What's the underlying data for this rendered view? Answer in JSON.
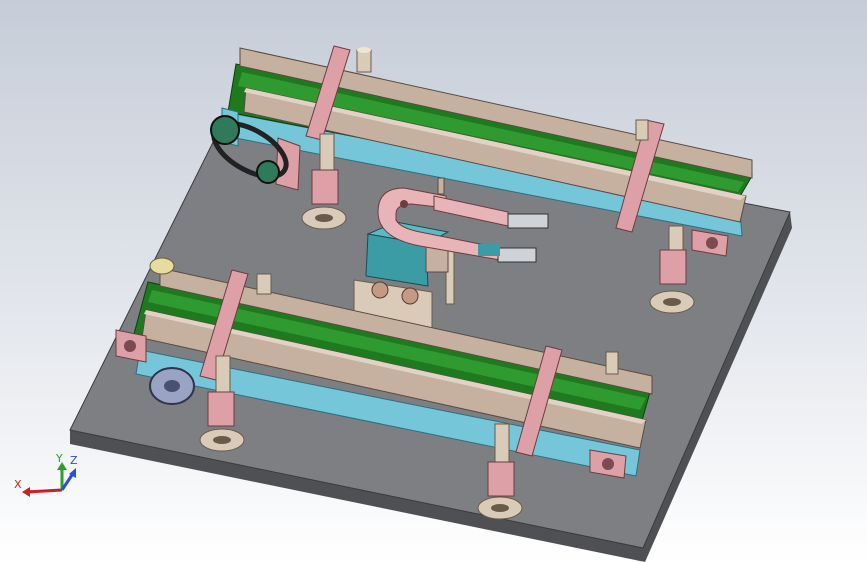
{
  "viewport": {
    "background_top": "#c6cdd8",
    "background_bottom": "#ffffff"
  },
  "model": {
    "plate_color": "#7d7f83",
    "conveyor_rail_color": "#c6b1a1",
    "belt_color": "#1f7a1f",
    "frame_color": "#74c6d8",
    "bracket_color": "#dda0a7",
    "gripper_color": "#e8b4b8",
    "block_color": "#3c9ca6"
  },
  "triad": {
    "x_label": "X",
    "y_label": "Y",
    "z_label": "Z",
    "x_color": "#cc1f1f",
    "y_color": "#2e9e2e",
    "z_color": "#2a4fd1"
  }
}
